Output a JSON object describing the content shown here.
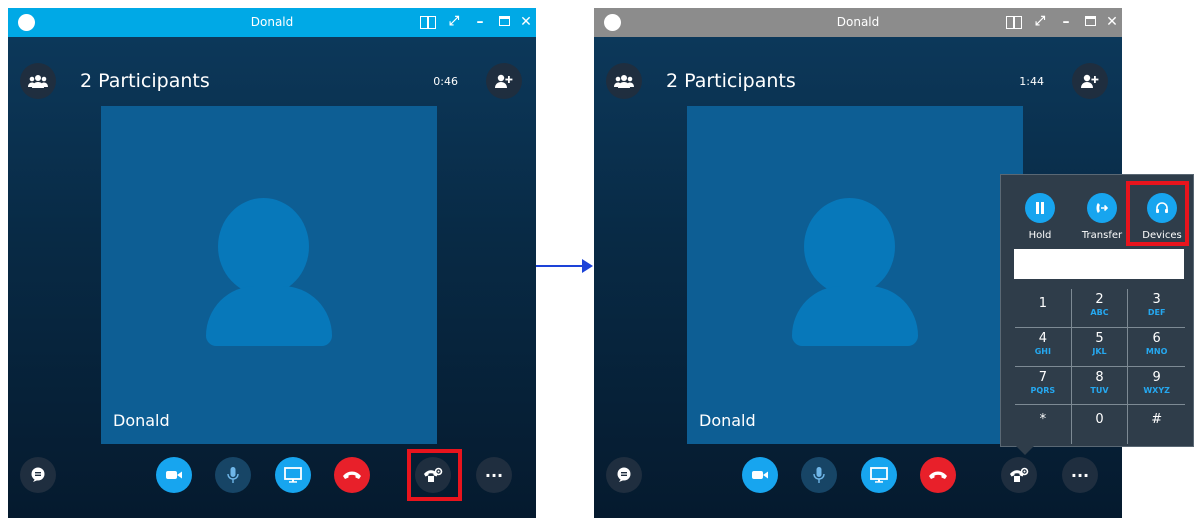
{
  "left": {
    "title": "Donald",
    "participants": "2 Participants",
    "timer": "0:46",
    "video_name": "Donald"
  },
  "right": {
    "title": "Donald",
    "participants": "2 Participants",
    "timer": "1:44",
    "video_name": "Donald"
  },
  "popup": {
    "hold": "Hold",
    "transfer": "Transfer",
    "devices": "Devices",
    "keys": [
      {
        "digit": "1",
        "letters": ""
      },
      {
        "digit": "2",
        "letters": "ABC"
      },
      {
        "digit": "3",
        "letters": "DEF"
      },
      {
        "digit": "4",
        "letters": "GHI"
      },
      {
        "digit": "5",
        "letters": "JKL"
      },
      {
        "digit": "6",
        "letters": "MNO"
      },
      {
        "digit": "7",
        "letters": "PQRS"
      },
      {
        "digit": "8",
        "letters": "TUV"
      },
      {
        "digit": "9",
        "letters": "WXYZ"
      },
      {
        "digit": "*",
        "letters": ""
      },
      {
        "digit": "0",
        "letters": ""
      },
      {
        "digit": "#",
        "letters": ""
      }
    ]
  },
  "icons": {
    "title_controls": [
      "skype-logo-icon",
      "layout-icon",
      "expand-icon",
      "minimize-icon",
      "maximize-icon",
      "close-icon"
    ],
    "bottom_controls": [
      "chat-icon",
      "video-camera-icon",
      "microphone-icon",
      "screen-share-icon",
      "hang-up-icon",
      "call-controls-icon",
      "more-options-icon"
    ]
  },
  "colors": {
    "title_active": "#00a9e6",
    "title_inactive": "#8c8c8c",
    "accent_blue": "#17a5ef",
    "hangup_red": "#e8202a",
    "highlight_red": "#e8141d",
    "arrow_blue": "#1d43d8"
  }
}
